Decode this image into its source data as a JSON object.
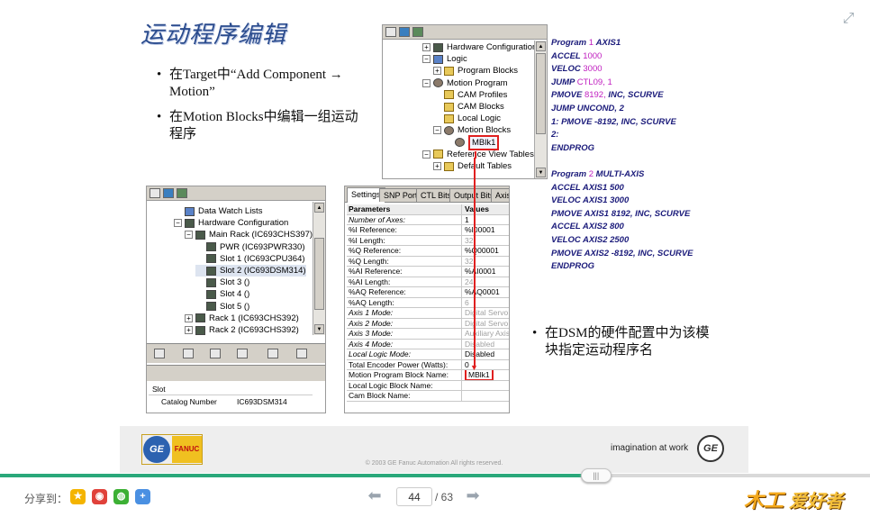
{
  "slide": {
    "title": "运动程序编辑",
    "bullets": [
      {
        "line1": "在Target中“Add Component →",
        "line2": "Motion”"
      },
      {
        "line1": "在Motion Blocks中编辑一组运动",
        "line2": "程序"
      },
      {
        "line1": "在DSM的硬件配置中为该模",
        "line2": "块指定运动程序名"
      }
    ]
  },
  "tree_top": [
    {
      "pm": "+",
      "icon": "rack",
      "label": "Hardware Configuration",
      "depth": 0
    },
    {
      "pm": "−",
      "icon": "blue",
      "label": "Logic",
      "depth": 0
    },
    {
      "pm": "+",
      "icon": "folder",
      "label": "Program Blocks",
      "depth": 1
    },
    {
      "pm": "−",
      "icon": "gear",
      "label": "Motion Program",
      "depth": 0
    },
    {
      "pm": "",
      "icon": "folder",
      "label": "CAM Profiles",
      "depth": 1
    },
    {
      "pm": "",
      "icon": "folder",
      "label": "CAM Blocks",
      "depth": 1
    },
    {
      "pm": "",
      "icon": "folder",
      "label": "Local Logic",
      "depth": 1
    },
    {
      "pm": "−",
      "icon": "gear",
      "label": "Motion Blocks",
      "depth": 1
    },
    {
      "pm": "",
      "icon": "gear",
      "label": "MBlk1",
      "depth": 2,
      "selected": true
    },
    {
      "pm": "−",
      "icon": "folder",
      "label": "Reference View Tables",
      "depth": 0
    },
    {
      "pm": "+",
      "icon": "folder",
      "label": "Default Tables",
      "depth": 1
    }
  ],
  "tree_left": [
    {
      "pm": "",
      "icon": "blue",
      "label": "Data Watch Lists",
      "depth": 0
    },
    {
      "pm": "−",
      "icon": "rack",
      "label": "Hardware Configuration",
      "depth": 0
    },
    {
      "pm": "−",
      "icon": "rack",
      "label": "Main Rack (IC693CHS397)",
      "depth": 1
    },
    {
      "pm": "",
      "icon": "rack",
      "label": "PWR (IC693PWR330)",
      "depth": 2
    },
    {
      "pm": "",
      "icon": "rack",
      "label": "Slot 1 (IC693CPU364)",
      "depth": 2
    },
    {
      "pm": "",
      "icon": "rack",
      "label": "Slot 2 (IC693DSM314)",
      "depth": 2,
      "highlight": true
    },
    {
      "pm": "",
      "icon": "rack",
      "label": "Slot 3 ()",
      "depth": 2
    },
    {
      "pm": "",
      "icon": "rack",
      "label": "Slot 4 ()",
      "depth": 2
    },
    {
      "pm": "",
      "icon": "rack",
      "label": "Slot 5 ()",
      "depth": 2
    },
    {
      "pm": "+",
      "icon": "rack",
      "label": "Rack 1 (IC693CHS392)",
      "depth": 1
    },
    {
      "pm": "+",
      "icon": "rack",
      "label": "Rack 2 (IC693CHS392)",
      "depth": 1
    }
  ],
  "slot_panel": {
    "header": "Slot",
    "catalog_label": "Catalog Number",
    "catalog_value": "IC693DSM314"
  },
  "prop_tabs": [
    "Settings",
    "SNP Port",
    "CTL Bits",
    "Output Bits",
    "Axis"
  ],
  "prop_grid": {
    "col_param": "Parameters",
    "col_value": "Values",
    "rows": [
      {
        "p": "Number of Axes:",
        "v": "1",
        "it": true,
        "gray": false
      },
      {
        "p": "%I Reference:",
        "v": "%I00001",
        "it": false,
        "gray": false
      },
      {
        "p": "%I Length:",
        "v": "32",
        "it": false,
        "gray": true
      },
      {
        "p": "%Q Reference:",
        "v": "%Q00001",
        "it": false,
        "gray": false
      },
      {
        "p": "%Q Length:",
        "v": "32",
        "it": false,
        "gray": true
      },
      {
        "p": "%AI Reference:",
        "v": "%AI0001",
        "it": false,
        "gray": false
      },
      {
        "p": "%AI Length:",
        "v": "24",
        "it": false,
        "gray": true
      },
      {
        "p": "%AQ Reference:",
        "v": "%AQ0001",
        "it": false,
        "gray": false
      },
      {
        "p": "%AQ Length:",
        "v": "6",
        "it": false,
        "gray": true
      },
      {
        "p": "Axis 1 Mode:",
        "v": "Digital Servo",
        "it": true,
        "gray": true
      },
      {
        "p": "Axis 2 Mode:",
        "v": "Digital Servo",
        "it": true,
        "gray": true
      },
      {
        "p": "Axis 3 Mode:",
        "v": "Auxiliary Axis",
        "it": true,
        "gray": true
      },
      {
        "p": "Axis 4 Mode:",
        "v": "Disabled",
        "it": true,
        "gray": true
      },
      {
        "p": "Local Logic Mode:",
        "v": "Disabled",
        "it": true,
        "gray": false
      },
      {
        "p": "Total Encoder Power (Watts):",
        "v": "0",
        "it": false,
        "gray": false
      },
      {
        "p": "Motion Program Block Name:",
        "v": "MBlk1",
        "it": false,
        "gray": false,
        "boxed": true
      },
      {
        "p": "Local Logic Block Name:",
        "v": "",
        "it": false,
        "gray": false
      },
      {
        "p": "Cam Block Name:",
        "v": "",
        "it": false,
        "gray": false
      }
    ]
  },
  "code": [
    {
      "kw": "Program",
      "num": "1",
      "arg": "AXIS1"
    },
    {
      "kw": "ACCEL",
      "num": "1000",
      "arg": ""
    },
    {
      "kw": "VELOC",
      "num": "3000",
      "arg": ""
    },
    {
      "kw": "JUMP",
      "num": "CTL09, 1",
      "arg": ""
    },
    {
      "kw": "PMOVE",
      "num": "8192,",
      "arg": "INC, SCURVE"
    },
    {
      "kw": "JUMP",
      "num": "",
      "arg": "UNCOND, 2"
    },
    {
      "kw": "1:",
      "num": "",
      "arg": "PMOVE -8192, INC, SCURVE"
    },
    {
      "kw": "2:",
      "num": "",
      "arg": ""
    },
    {
      "kw": "ENDPROG",
      "num": "",
      "arg": ""
    },
    {
      "kw": "",
      "num": "",
      "arg": ""
    },
    {
      "kw": "Program",
      "num": "2",
      "arg": "MULTI-AXIS"
    },
    {
      "kw": "ACCEL",
      "num": "",
      "arg": "AXIS1 500"
    },
    {
      "kw": "VELOC",
      "num": "",
      "arg": "AXIS1 3000"
    },
    {
      "kw": "PMOVE",
      "num": "",
      "arg": "AXIS1 8192, INC, SCURVE"
    },
    {
      "kw": "ACCEL",
      "num": "",
      "arg": "AXIS2 800"
    },
    {
      "kw": "VELOC",
      "num": "",
      "arg": "AXIS2 2500"
    },
    {
      "kw": "PMOVE",
      "num": "",
      "arg": "AXIS2 -8192, INC, SCURVE"
    },
    {
      "kw": "ENDPROG",
      "num": "",
      "arg": ""
    }
  ],
  "banner": {
    "ge": "GE",
    "fanuc": "FANUC",
    "tagline": "imagination at work",
    "copyright": "© 2003 GE Fanuc Automation  All rights reserved."
  },
  "viewer": {
    "progress": 0.685,
    "knob_label": "|||",
    "share_label": "分享到：",
    "page_current": "44",
    "page_total": "/ 63",
    "brand_part1": "木工",
    "brand_part2": "爱好者"
  },
  "colors": {
    "accent_green": "#2aa87a",
    "title_blue": "#2a4b8d",
    "highlight_red": "#e02020",
    "code_magenta": "#c020c0"
  }
}
